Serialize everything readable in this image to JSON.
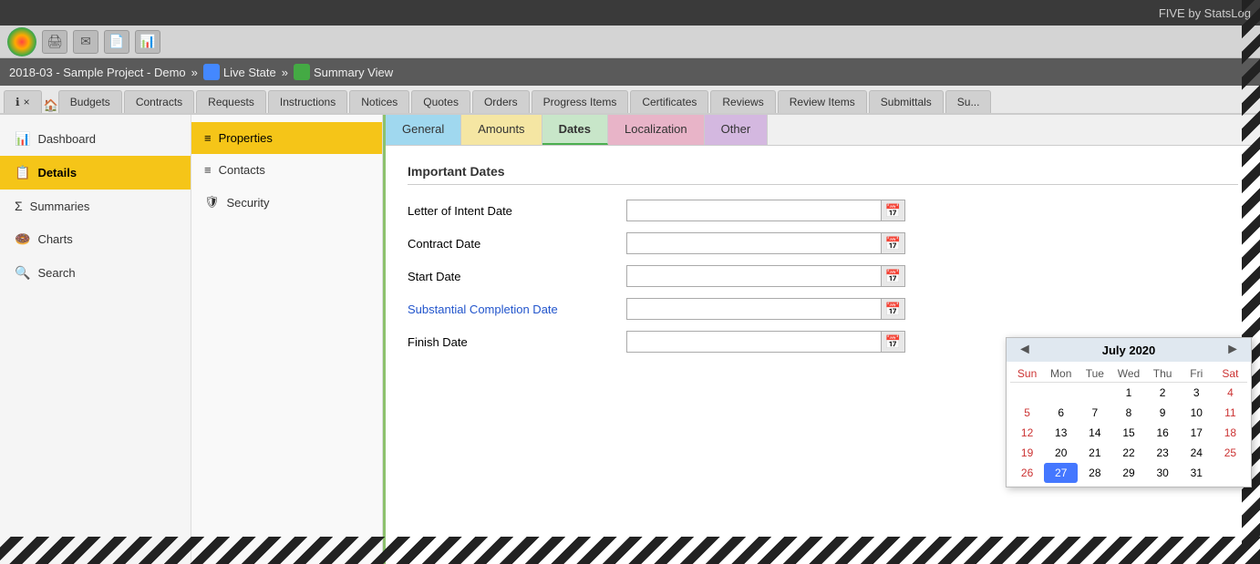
{
  "titleBar": {
    "text": "FIVE by StatsLog"
  },
  "breadcrumb": {
    "project": "2018-03 - Sample Project - Demo",
    "separator1": "»",
    "liveState": "Live State",
    "separator2": "»",
    "summaryView": "Summary View"
  },
  "tabBar": {
    "closeLabel": "×",
    "homeLabel": "🏠",
    "tabs": [
      {
        "label": "Budgets"
      },
      {
        "label": "Contracts"
      },
      {
        "label": "Requests"
      },
      {
        "label": "Instructions"
      },
      {
        "label": "Notices"
      },
      {
        "label": "Quotes"
      },
      {
        "label": "Orders"
      },
      {
        "label": "Progress Items"
      },
      {
        "label": "Certificates"
      },
      {
        "label": "Reviews"
      },
      {
        "label": "Review Items"
      },
      {
        "label": "Submittals"
      },
      {
        "label": "Su..."
      }
    ]
  },
  "sidebar": {
    "items": [
      {
        "label": "Dashboard",
        "icon": "📊",
        "id": "dashboard"
      },
      {
        "label": "Details",
        "icon": "📋",
        "id": "details",
        "active": true
      },
      {
        "label": "Summaries",
        "icon": "Σ",
        "id": "summaries"
      },
      {
        "label": "Charts",
        "icon": "🍩",
        "id": "charts"
      },
      {
        "label": "Search",
        "icon": "🔍",
        "id": "search"
      }
    ]
  },
  "subSidebar": {
    "items": [
      {
        "label": "Properties",
        "icon": "≡",
        "id": "properties",
        "active": true
      },
      {
        "label": "Contacts",
        "icon": "≡",
        "id": "contacts"
      },
      {
        "label": "Security",
        "icon": "🛡",
        "id": "security"
      }
    ]
  },
  "innerTabs": [
    {
      "label": "General",
      "id": "general",
      "class": "general"
    },
    {
      "label": "Amounts",
      "id": "amounts",
      "class": "amounts"
    },
    {
      "label": "Dates",
      "id": "dates",
      "class": "dates",
      "active": true
    },
    {
      "label": "Localization",
      "id": "localization",
      "class": "localization"
    },
    {
      "label": "Other",
      "id": "other",
      "class": "other"
    }
  ],
  "importantDates": {
    "sectionTitle": "Important Dates",
    "fields": [
      {
        "label": "Letter of Intent Date",
        "isBlue": false,
        "id": "letter-of-intent"
      },
      {
        "label": "Contract Date",
        "isBlue": false,
        "id": "contract-date"
      },
      {
        "label": "Start Date",
        "isBlue": false,
        "id": "start-date"
      },
      {
        "label": "Substantial Completion Date",
        "isBlue": true,
        "id": "substantial-completion"
      },
      {
        "label": "Finish Date",
        "isBlue": false,
        "id": "finish-date"
      }
    ]
  },
  "calendar": {
    "title": "July 2020",
    "prevLabel": "◄",
    "nextLabel": "►",
    "daysOfWeek": [
      "Sun",
      "Mon",
      "Tue",
      "Wed",
      "Thu",
      "Fri",
      "Sat"
    ],
    "weeks": [
      [
        "",
        "",
        "",
        "1",
        "2",
        "3",
        "4"
      ],
      [
        "5",
        "6",
        "7",
        "8",
        "9",
        "10",
        "11"
      ],
      [
        "12",
        "13",
        "14",
        "15",
        "16",
        "17",
        "18"
      ],
      [
        "19",
        "20",
        "21",
        "22",
        "23",
        "24",
        "25"
      ],
      [
        "26",
        "27",
        "28",
        "29",
        "30",
        "31",
        ""
      ]
    ],
    "today": "27"
  }
}
